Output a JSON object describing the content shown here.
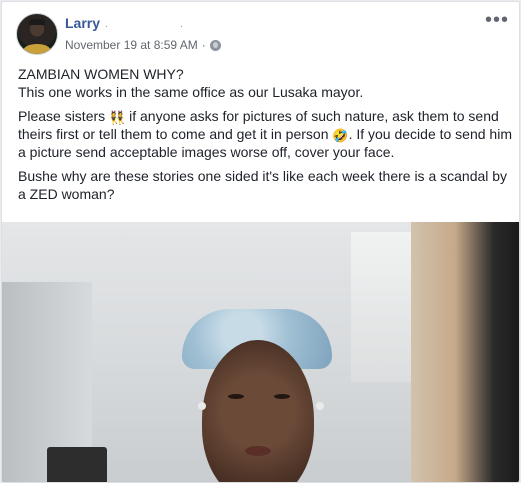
{
  "post": {
    "author": "Larry",
    "timestamp": "November 19 at 8:59 AM",
    "separator": "·",
    "privacy_icon": "globe-icon",
    "more_icon": "more-options-icon",
    "paragraphs": {
      "p1_line1": "ZAMBIAN WOMEN WHY?",
      "p1_line2": "This one works in the same office as our Lusaka mayor.",
      "p2_part1": "Please sisters ",
      "p2_emoji1": "👯",
      "p2_part2": " if anyone asks for pictures of such nature, ask them to send theirs first or tell them to come and get it in person ",
      "p2_emoji2": "🤣",
      "p2_part3": ". If you decide to send him a picture send acceptable images worse off, cover your face.",
      "p3": "Bushe why are these stories one sided it's like each week there is a scandal by a ZED woman?"
    }
  },
  "colors": {
    "author_link": "#385898",
    "meta_text": "#616770",
    "body_text": "#1d2129",
    "card_border": "#dddfe2",
    "page_bg": "#e9ebee"
  }
}
